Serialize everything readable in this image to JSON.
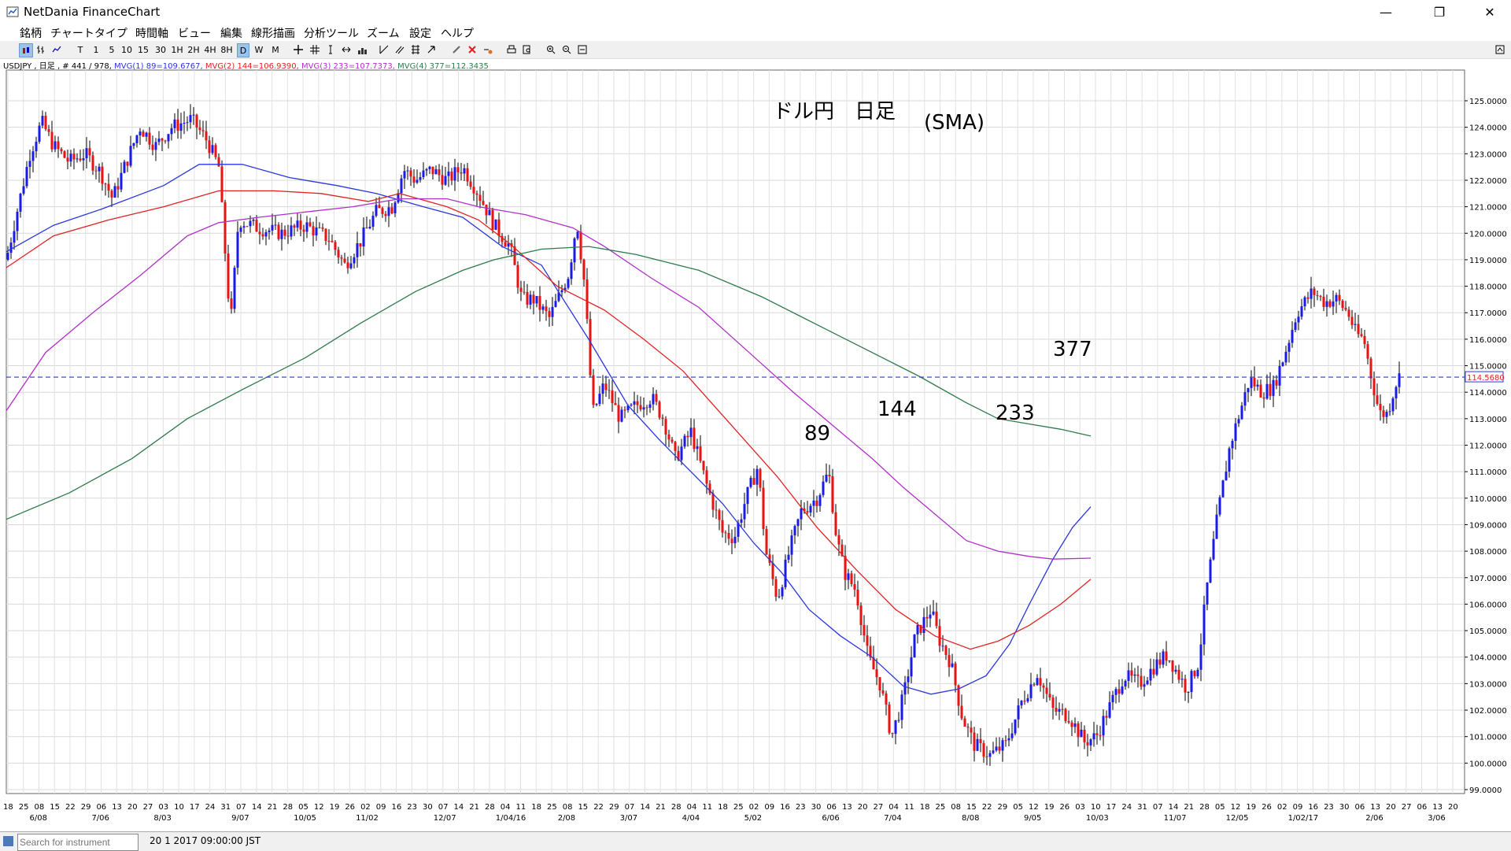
{
  "window": {
    "title": "NetDania FinanceChart",
    "minimize": "—",
    "maximize": "❐",
    "close": "✕"
  },
  "menu": [
    "銘柄",
    "チャートタイプ",
    "時間軸",
    "ビュー",
    "編集",
    "線形描画",
    "分析ツール",
    "ズーム",
    "設定",
    "ヘルプ"
  ],
  "toolbar": {
    "timeframes": [
      "T",
      "1",
      "5",
      "10",
      "15",
      "30",
      "1H",
      "2H",
      "4H",
      "8H",
      "D",
      "W",
      "M"
    ],
    "selected": "D"
  },
  "info_line": {
    "symbol": "USDJPY , 日足 , # 441 / 978,",
    "mvg1": "MVG(1) 89=109.6767,",
    "mvg2": "MVG(2) 144=106.9390,",
    "mvg3": "MVG(3) 233=107.7373,",
    "mvg4": "MVG(4) 377=112.3435"
  },
  "status": {
    "search_placeholder": "Search for instrument",
    "datetime": "20 1 2017 09:00:00 JST"
  },
  "colors": {
    "up": "#1a1aee",
    "down": "#ee1111",
    "ma89": "#2a36e0",
    "ma144": "#e02222",
    "ma233": "#b030c8",
    "ma377": "#2e7a4a"
  },
  "chart_data": {
    "type": "candlestick",
    "symbol": "USDJPY",
    "title": "ドル円　日足",
    "subtitle": "(SMA)",
    "ylim": [
      99.0,
      125.0
    ],
    "current_price": 114.568,
    "current_price_label": "114.5680",
    "y_ticks": [
      "125.0000",
      "124.0000",
      "123.0000",
      "122.0000",
      "121.0000",
      "120.0000",
      "119.0000",
      "118.0000",
      "117.0000",
      "116.0000",
      "115.0000",
      "114.0000",
      "113.0000",
      "112.0000",
      "111.0000",
      "110.0000",
      "109.0000",
      "108.0000",
      "107.0000",
      "106.0000",
      "105.0000",
      "104.0000",
      "103.0000",
      "102.0000",
      "101.0000",
      "100.0000",
      "99.0000"
    ],
    "x_day_labels": [
      "18",
      "25",
      "08",
      "15",
      "22",
      "29",
      "06",
      "13",
      "20",
      "27",
      "03",
      "10",
      "17",
      "24",
      "31",
      "07",
      "14",
      "21",
      "28",
      "05",
      "12",
      "19",
      "26",
      "02",
      "09",
      "16",
      "23",
      "30",
      "07",
      "14",
      "21",
      "28",
      "04",
      "11",
      "18",
      "25",
      "08",
      "15",
      "22",
      "29",
      "07",
      "14",
      "21",
      "28",
      "04",
      "11",
      "18",
      "25",
      "02",
      "09",
      "16",
      "23",
      "30",
      "06",
      "13",
      "20",
      "27",
      "04",
      "11",
      "18",
      "25",
      "08",
      "15",
      "22",
      "29",
      "05",
      "12",
      "19",
      "26",
      "03",
      "10",
      "17",
      "24",
      "31",
      "07",
      "14",
      "21",
      "28",
      "05",
      "12",
      "19",
      "26",
      "02",
      "09",
      "16",
      "23",
      "30",
      "06",
      "13",
      "20",
      "27",
      "06",
      "13",
      "20"
    ],
    "x_month_labels": [
      "6/08",
      "7/06",
      "8/03",
      "9/07",
      "10/05",
      "11/02",
      "12/07",
      "1/04/16",
      "2/08",
      "3/07",
      "4/04",
      "5/02",
      "6/06",
      "7/04",
      "8/08",
      "9/05",
      "10/03",
      "11/07",
      "12/05",
      "1/02/17",
      "2/06",
      "3/06"
    ],
    "annotations": [
      "89",
      "144",
      "233",
      "377"
    ],
    "series": [
      {
        "name": "89",
        "points": [
          [
            0,
            119.3
          ],
          [
            60,
            120.3
          ],
          [
            120,
            120.9
          ],
          [
            200,
            121.8
          ],
          [
            245,
            122.6
          ],
          [
            300,
            122.6
          ],
          [
            360,
            122.1
          ],
          [
            420,
            121.8
          ],
          [
            470,
            121.5
          ],
          [
            530,
            121.0
          ],
          [
            580,
            120.6
          ],
          [
            630,
            119.5
          ],
          [
            680,
            118.8
          ],
          [
            740,
            116.0
          ],
          [
            790,
            113.5
          ],
          [
            830,
            112.2
          ],
          [
            870,
            111.0
          ],
          [
            910,
            109.8
          ],
          [
            950,
            108.3
          ],
          [
            985,
            107.2
          ],
          [
            1020,
            105.8
          ],
          [
            1060,
            104.8
          ],
          [
            1100,
            104.0
          ],
          [
            1140,
            102.9
          ],
          [
            1175,
            102.6
          ],
          [
            1210,
            102.8
          ],
          [
            1245,
            103.3
          ],
          [
            1275,
            104.5
          ],
          [
            1300,
            106.0
          ],
          [
            1330,
            107.7
          ],
          [
            1355,
            108.9
          ],
          [
            1378,
            109.677
          ]
        ]
      },
      {
        "name": "144",
        "points": [
          [
            0,
            118.7
          ],
          [
            60,
            119.9
          ],
          [
            130,
            120.5
          ],
          [
            200,
            121.0
          ],
          [
            270,
            121.6
          ],
          [
            340,
            121.6
          ],
          [
            400,
            121.5
          ],
          [
            460,
            121.2
          ],
          [
            500,
            121.5
          ],
          [
            560,
            121.0
          ],
          [
            600,
            120.5
          ],
          [
            640,
            119.6
          ],
          [
            700,
            118.0
          ],
          [
            760,
            117.1
          ],
          [
            810,
            116.0
          ],
          [
            860,
            114.8
          ],
          [
            920,
            112.8
          ],
          [
            980,
            110.8
          ],
          [
            1030,
            108.9
          ],
          [
            1080,
            107.3
          ],
          [
            1130,
            105.8
          ],
          [
            1180,
            104.8
          ],
          [
            1225,
            104.3
          ],
          [
            1260,
            104.6
          ],
          [
            1300,
            105.2
          ],
          [
            1340,
            106.0
          ],
          [
            1378,
            106.939
          ]
        ]
      },
      {
        "name": "233",
        "points": [
          [
            0,
            113.3
          ],
          [
            50,
            115.5
          ],
          [
            110,
            117.0
          ],
          [
            170,
            118.4
          ],
          [
            230,
            119.9
          ],
          [
            270,
            120.4
          ],
          [
            320,
            120.6
          ],
          [
            380,
            120.8
          ],
          [
            440,
            121.0
          ],
          [
            500,
            121.3
          ],
          [
            560,
            121.3
          ],
          [
            600,
            121.0
          ],
          [
            660,
            120.7
          ],
          [
            720,
            120.2
          ],
          [
            760,
            119.5
          ],
          [
            820,
            118.3
          ],
          [
            880,
            117.2
          ],
          [
            940,
            115.6
          ],
          [
            1000,
            114.0
          ],
          [
            1060,
            112.5
          ],
          [
            1100,
            111.5
          ],
          [
            1140,
            110.4
          ],
          [
            1180,
            109.4
          ],
          [
            1220,
            108.4
          ],
          [
            1260,
            108.0
          ],
          [
            1300,
            107.8
          ],
          [
            1330,
            107.7
          ],
          [
            1378,
            107.737
          ]
        ]
      },
      {
        "name": "377",
        "points": [
          [
            0,
            109.2
          ],
          [
            80,
            110.2
          ],
          [
            160,
            111.5
          ],
          [
            230,
            113.0
          ],
          [
            300,
            114.1
          ],
          [
            380,
            115.3
          ],
          [
            450,
            116.6
          ],
          [
            520,
            117.8
          ],
          [
            580,
            118.6
          ],
          [
            620,
            119.0
          ],
          [
            680,
            119.4
          ],
          [
            740,
            119.5
          ],
          [
            800,
            119.2
          ],
          [
            880,
            118.6
          ],
          [
            960,
            117.6
          ],
          [
            1040,
            116.4
          ],
          [
            1100,
            115.5
          ],
          [
            1160,
            114.6
          ],
          [
            1220,
            113.6
          ],
          [
            1260,
            113.0
          ],
          [
            1300,
            112.8
          ],
          [
            1340,
            112.6
          ],
          [
            1378,
            112.344
          ]
        ]
      }
    ]
  }
}
